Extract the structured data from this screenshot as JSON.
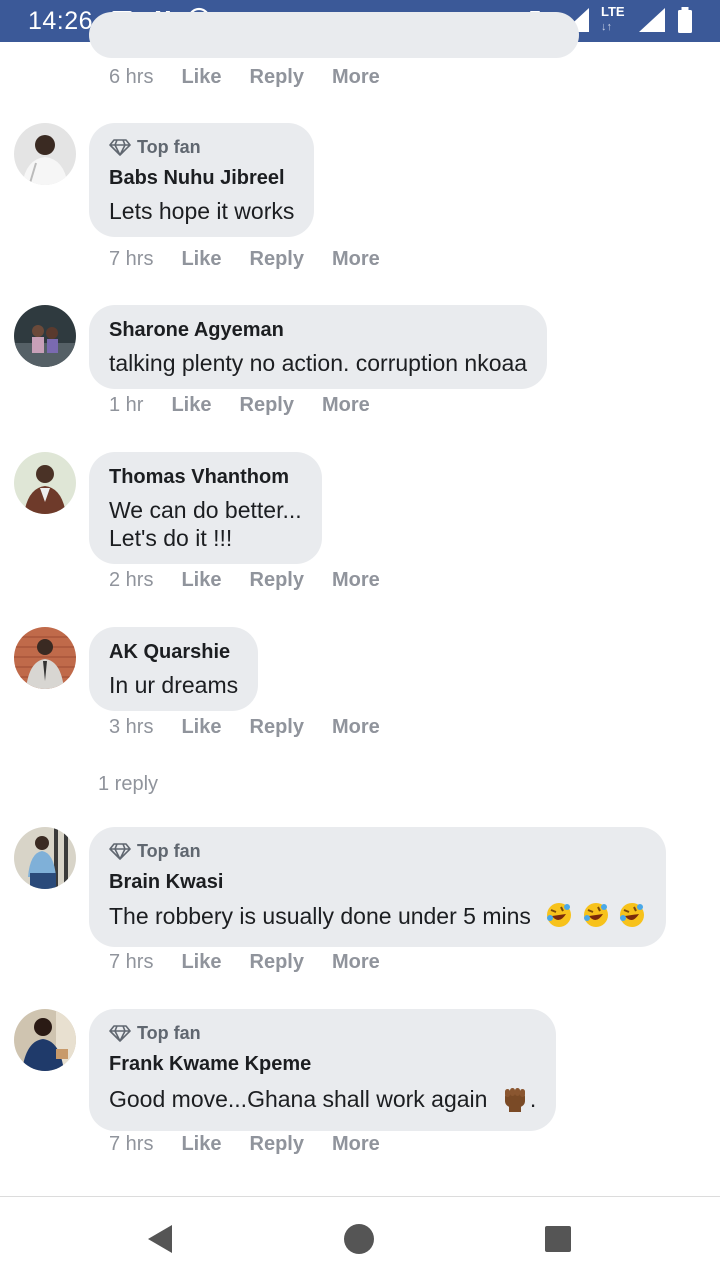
{
  "status_bar": {
    "time": "14:26",
    "network": "LTE",
    "icons": [
      "image-icon",
      "n-app-icon",
      "whatsapp-icon",
      "vibrate-icon",
      "signal-icon",
      "battery-icon"
    ]
  },
  "partial_comment": {
    "time": "6 hrs"
  },
  "actions": {
    "like": "Like",
    "reply": "Reply",
    "more": "More"
  },
  "top_fan_label": "Top fan",
  "comments": [
    {
      "top_fan": true,
      "author": "Babs Nuhu Jibreel",
      "lines": [
        "Lets hope it works"
      ],
      "time": "7 hrs"
    },
    {
      "top_fan": false,
      "author": "Sharone Agyeman",
      "lines": [
        "talking plenty no action. corruption nkoaa"
      ],
      "time": "1 hr"
    },
    {
      "top_fan": false,
      "author": "Thomas Vhanthom",
      "lines": [
        "We can do better...",
        "Let's do it !!!"
      ],
      "time": "2 hrs"
    },
    {
      "top_fan": false,
      "author": "AK Quarshie",
      "lines": [
        "In ur dreams"
      ],
      "time": "3 hrs",
      "replies_label": "1 reply"
    },
    {
      "top_fan": true,
      "author": "Brain Kwasi",
      "lines": [
        "The robbery is usually done under 5 mins"
      ],
      "emoji": "rolling-laughing-emoji x3",
      "time": "7 hrs"
    },
    {
      "top_fan": true,
      "author": "Frank Kwame Kpeme",
      "lines": [
        "Good move...Ghana shall work again"
      ],
      "emoji": "raised-fist-emoji",
      "trailing": ".",
      "time": "7 hrs"
    }
  ],
  "colors": {
    "status_bar": "#3b5998",
    "bubble": "#e9ebee",
    "meta": "#90949c"
  }
}
